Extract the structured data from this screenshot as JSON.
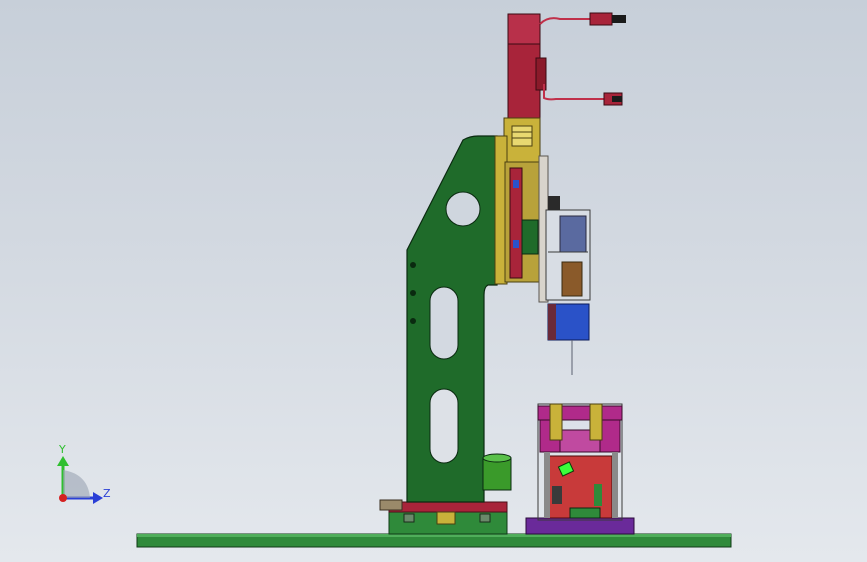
{
  "viewport": {
    "background_top": "#c7cfd9",
    "background_bottom": "#e4e8ed"
  },
  "triad": {
    "y_label": "Y",
    "z_label": "Z",
    "y_color": "#2fbf2f",
    "z_color": "#2a3fd6",
    "origin_color": "#d42020"
  },
  "colors": {
    "frame_green": "#1f6b2a",
    "base_green": "#2f8a3a",
    "motor_red": "#a8243a",
    "bracket_yellow": "#c9b23a",
    "fixture_magenta": "#b02a8a",
    "block_blue": "#2a52c8",
    "plate_purple": "#6a2a9a",
    "cylinder_green": "#3a9a2a"
  },
  "model": {
    "name": "press-assembly",
    "parts": [
      "c-frame",
      "servo-motor",
      "slide-carriage",
      "camera-module",
      "pressing-block",
      "fixture",
      "base-plate",
      "motor-cable-upper",
      "motor-cable-lower",
      "side-cylinder"
    ]
  }
}
